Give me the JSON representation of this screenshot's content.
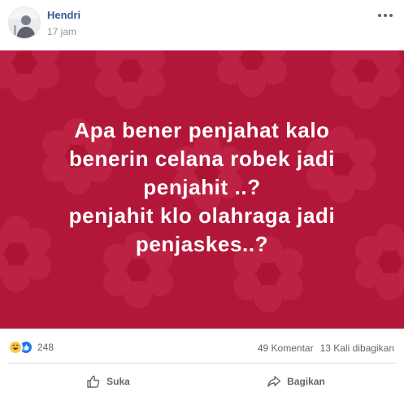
{
  "header": {
    "author": "Hendri",
    "time": "17 jam"
  },
  "banner": {
    "lines": [
      "Apa bener penjahat kalo",
      "benerin celana robek jadi",
      "penjahit ..?",
      "penjahit klo olahraga jadi",
      "penjaskes..?"
    ],
    "background_color": "#b3183a",
    "text_color": "#ffffff"
  },
  "stats": {
    "reaction_icons": [
      "haha-icon",
      "like-icon"
    ],
    "reaction_count": "248",
    "comments": "49 Komentar",
    "shares": "13 Kali dibagikan"
  },
  "actions": {
    "like_label": "Suka",
    "share_label": "Bagikan"
  },
  "colors": {
    "author_link": "#385898",
    "secondary_text": "#90949c",
    "action_text": "#606770",
    "like_blue": "#2078f4",
    "haha_yellow": "#f7c84a"
  }
}
